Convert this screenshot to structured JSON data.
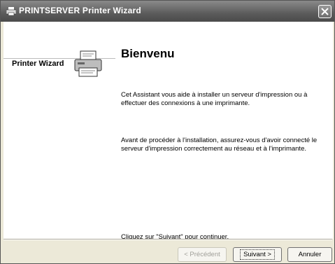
{
  "window": {
    "title": "PRINTSERVER Printer Wizard"
  },
  "sidebar": {
    "label": "Printer Wizard"
  },
  "main": {
    "heading": "Bienvenu",
    "paragraph1": "Cet Assistant vous aide à installer un serveur d'impression ou à effectuer des connexions à une imprimante.",
    "paragraph2": "Avant de procéder à l'installation, assurez-vous d'avoir connecté le serveur d'impression correctement au réseau et à l'imprimante.",
    "paragraph3": "Cliquez sur \"Suivant\" pour continuer."
  },
  "buttons": {
    "previous": "< Précédent",
    "next": "Suivant >",
    "cancel": "Annuler"
  },
  "icons": {
    "title": "printer-icon",
    "close": "close-icon",
    "wizard": "printer-wizard-icon"
  }
}
